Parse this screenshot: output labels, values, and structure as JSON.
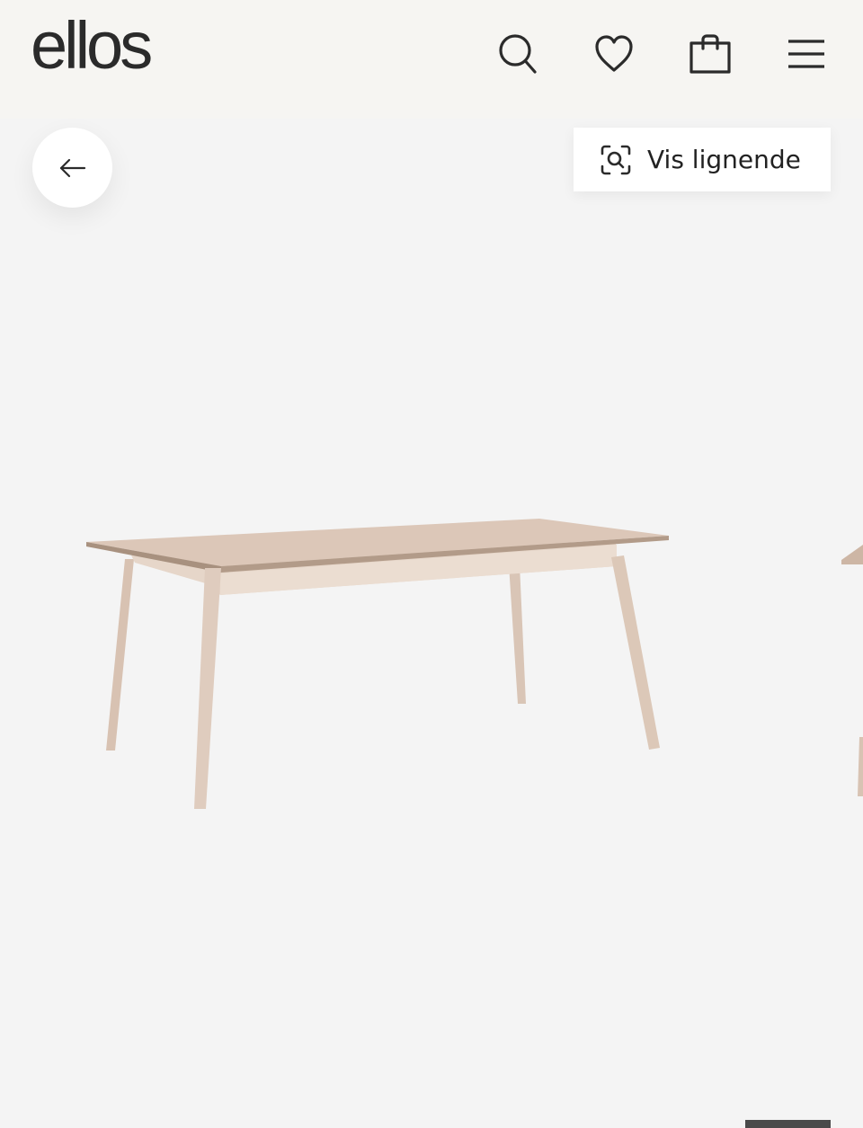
{
  "header": {
    "logo": "ellos",
    "icons": [
      "search-icon",
      "heart-icon",
      "shopping-bag-icon",
      "menu-icon"
    ]
  },
  "product_view": {
    "back_icon": "arrow-left-icon",
    "similar_button": {
      "icon": "visual-search-icon",
      "label": "Vis lignende"
    },
    "image_subject": "dining-table",
    "colors": {
      "background": "#f4f4f4",
      "header_background": "#f6f5f2",
      "wood": "#dcc8b8",
      "text": "#222222"
    }
  }
}
